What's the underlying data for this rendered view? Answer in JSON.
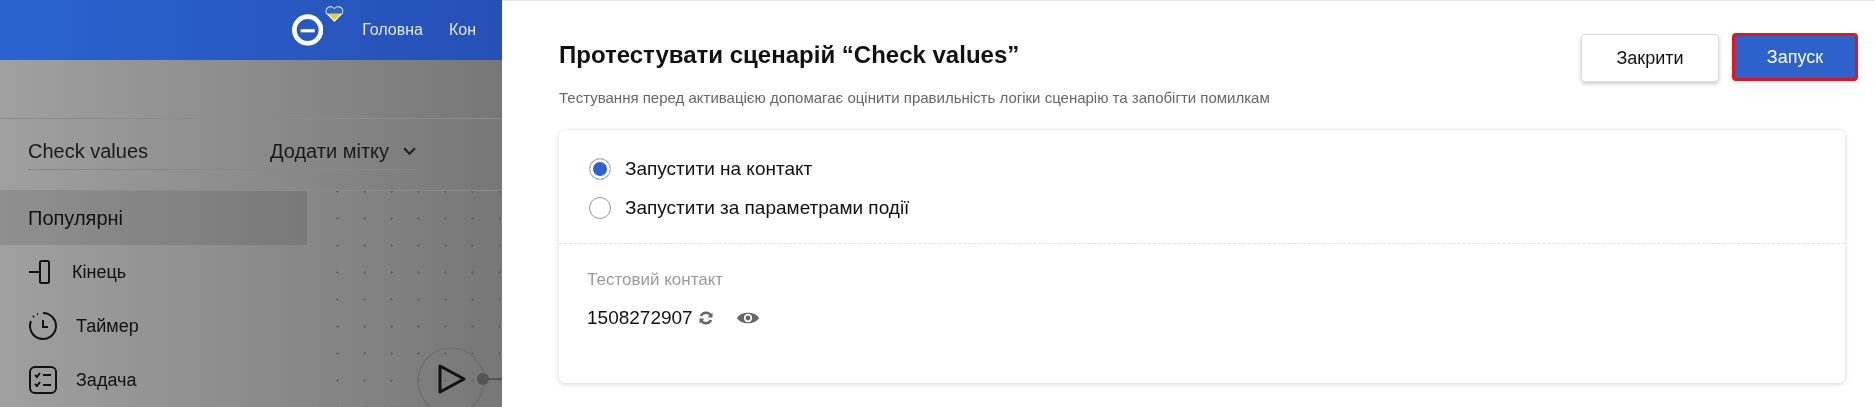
{
  "header": {
    "nav": [
      {
        "label": "Головна"
      },
      {
        "label": "Кон"
      }
    ]
  },
  "scenario": {
    "name": "Check values",
    "tag_select": "Додати мітку"
  },
  "palette": {
    "group": "Популярні",
    "items": [
      {
        "label": "Кінець",
        "kind": "end"
      },
      {
        "label": "Таймер",
        "kind": "timer"
      },
      {
        "label": "Задача",
        "kind": "task"
      }
    ]
  },
  "dialog": {
    "title": "Протестувати сценарій “Check values”",
    "subtitle": "Тестування перед активацією допомагає оцінити правильність логіки сценарію та запобігти помилкам",
    "buttons": [
      {
        "label": "Закрити",
        "kind": "secondary",
        "highlighted": false
      },
      {
        "label": "Запуск",
        "kind": "primary",
        "highlighted": true
      }
    ],
    "modes": [
      {
        "label": "Запустити на контакт",
        "selected": true
      },
      {
        "label": "Запустити за параметрами події",
        "selected": false
      }
    ],
    "test_contact": {
      "label": "Тестовий контакт",
      "value": "1508272907"
    }
  }
}
